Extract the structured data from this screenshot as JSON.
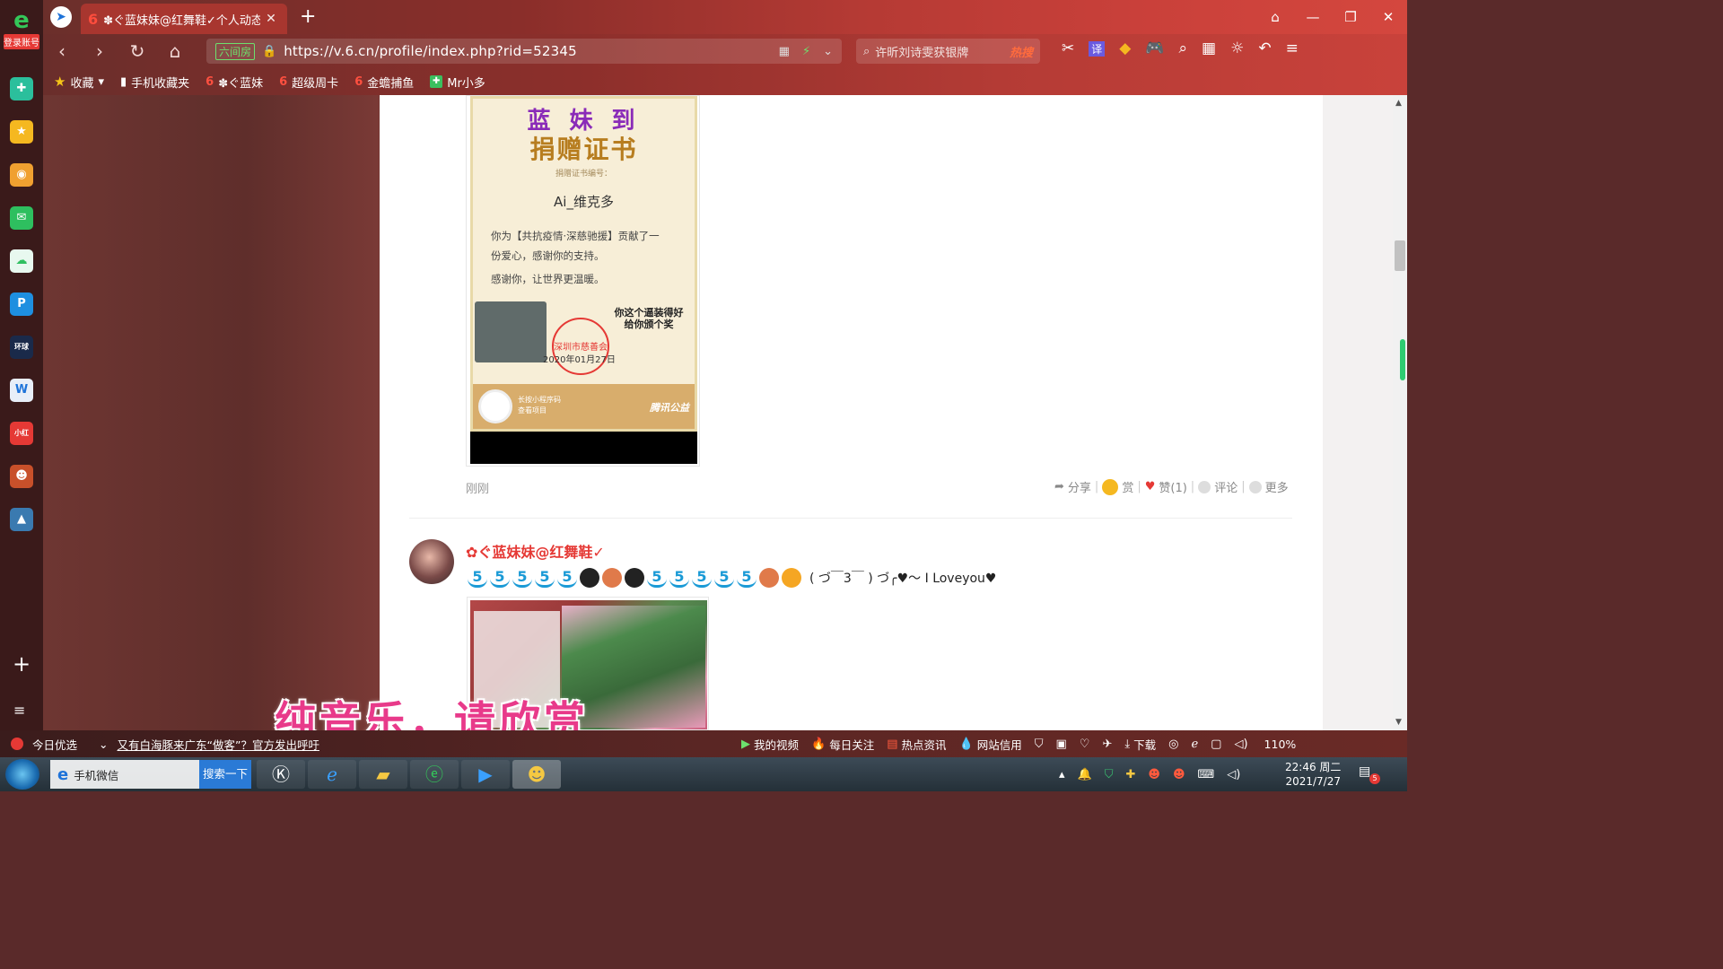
{
  "browser": {
    "tab_title": "✽ぐ蓝妹妹@红舞鞋✓个人动态",
    "url": "https://v.6.cn/profile/index.php?rid=52345",
    "site_badge": "六间房",
    "search_text": "许昕刘诗雯获银牌",
    "search_hot": "热搜"
  },
  "bookmarks": [
    {
      "label": "收藏",
      "icon": "star-icon"
    },
    {
      "label": "手机收藏夹",
      "icon": "phone-icon"
    },
    {
      "label": "✽ぐ蓝妹",
      "icon": "six-icon"
    },
    {
      "label": "超级周卡",
      "icon": "six-icon"
    },
    {
      "label": "金蟾捕鱼",
      "icon": "six-icon"
    },
    {
      "label": "Mr小多",
      "icon": "app-icon"
    }
  ],
  "sidebar": {
    "login_label": "登录账号",
    "plus": "+",
    "list": "≡"
  },
  "certificate": {
    "name_overlay": "蓝 妹 到",
    "title": "捐赠证书",
    "number_label": "捐赠证书编号：",
    "donor": "Ai_维克多",
    "body_line1": "你为【共抗疫情·深慈驰援】贡献了一",
    "body_line2": "份爱心，感谢你的支持。",
    "body_line3": "感谢你，让世界更温暖。",
    "stamp_text": "深圳市慈善会",
    "date": "2020年01月27日",
    "meme_text": "你这个逼装得好\n给你颁个奖",
    "mini_program": "长按小程序码\n查看项目",
    "tencent_label": "腾讯公益"
  },
  "post1": {
    "time": "刚刚",
    "actions": {
      "share": "分享",
      "reward": "赏",
      "like": "赞(1)",
      "comment": "评论",
      "more": "更多"
    }
  },
  "post2": {
    "username": "✿ぐ蓝妹妹@红舞鞋✓",
    "text": "( づ￣3￣ ) づ╭♥～ I  Loveyou♥"
  },
  "caption": "纯音乐，请欣赏",
  "statusbar": {
    "today": "今日优选",
    "news": "又有白海豚来广东“做客”？官方发出呼吁",
    "my_video": "我的视频",
    "daily": "每日关注",
    "hot_news": "热点资讯",
    "credit": "网站信用",
    "download": "下载",
    "zoom": "110%"
  },
  "taskbar": {
    "weixin": "手机微信",
    "search_btn": "搜索一下",
    "time": "22:46 周二",
    "date": "2021/7/27",
    "notif_count": "5"
  }
}
